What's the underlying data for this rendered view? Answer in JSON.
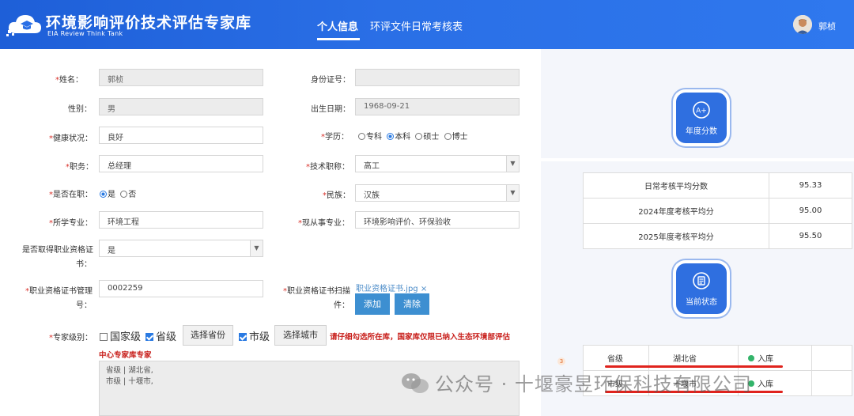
{
  "header": {
    "logo_title": "环境影响评价技术评估专家库",
    "logo_subtitle": "EIA Review Think Tank",
    "nav": [
      {
        "label": "个人信息",
        "active": true
      },
      {
        "label": "环评文件日常考核表",
        "active": false
      }
    ],
    "user_name": "郭桢",
    "color_primary": "#2a6fe6"
  },
  "form": {
    "name_label": "姓名：",
    "name_value": "郭桢",
    "id_label": "身份证号：",
    "id_value": "",
    "gender_label": "性别：",
    "gender_value": "男",
    "birth_label": "出生日期：",
    "birth_value": "1968-09-21",
    "health_label": "健康状况：",
    "health_value": "良好",
    "education_label": "学历：",
    "education_options": [
      "专科",
      "本科",
      "硕士",
      "博士"
    ],
    "education_selected": "本科",
    "position_label": "职务：",
    "position_value": "总经理",
    "title_label": "技术职称：",
    "title_value": "高工",
    "employed_label": "是否在职：",
    "employed_options": [
      "是",
      "否"
    ],
    "employed_selected": "是",
    "ethnicity_label": "民族：",
    "ethnicity_value": "汉族",
    "major_label": "所学专业：",
    "major_value": "环境工程",
    "current_major_label": "现从事专业：",
    "current_major_value": "环境影响评价、环保验收",
    "cert_obtained_label_1": "是否取得职业资格证",
    "cert_obtained_label_2": "书：",
    "cert_obtained_value": "是",
    "cert_no_label_1": "职业资格证书管理",
    "cert_no_label_2": "号：",
    "cert_no_value": "0002259",
    "cert_scan_label_1": "职业资格证书扫描",
    "cert_scan_label_2": "件：",
    "cert_file": "职业资格证书.jpg",
    "cert_file_remove": "×",
    "add_button": "添加",
    "clear_button": "清除",
    "expert_level_label": "专家级别：",
    "level_national": "国家级",
    "level_province": "省级",
    "select_province_button": "选择省份",
    "level_city": "市级",
    "select_city_button": "选择城市",
    "warning_line_1": "请仔细勾选所在库，国家库仅限已纳入生态环境部评估",
    "warning_line_2": "中心专家库专家",
    "region_line_1": "省级 | 湖北省,",
    "region_line_2": "市级 | 十堰市,",
    "color_required": "#d9312b"
  },
  "right": {
    "annual_score_label": "年度分数",
    "annual_score_icon": "a-plus-badge-icon",
    "scores": [
      {
        "label": "日常考核平均分数",
        "value": "95.33"
      },
      {
        "label": "2024年度考核平均分",
        "value": "95.00"
      },
      {
        "label": "2025年度考核平均分",
        "value": "95.50"
      }
    ],
    "status_label": "当前状态",
    "status_icon": "document-icon",
    "badge_number": "3",
    "status_rows": [
      {
        "level": "省级",
        "region": "湖北省",
        "status": "入库"
      },
      {
        "level": "市级",
        "region": "十堰市",
        "status": "入库"
      }
    ]
  },
  "watermark": {
    "text": "公众号 · 十堰豪昱环保科技有限公司"
  }
}
